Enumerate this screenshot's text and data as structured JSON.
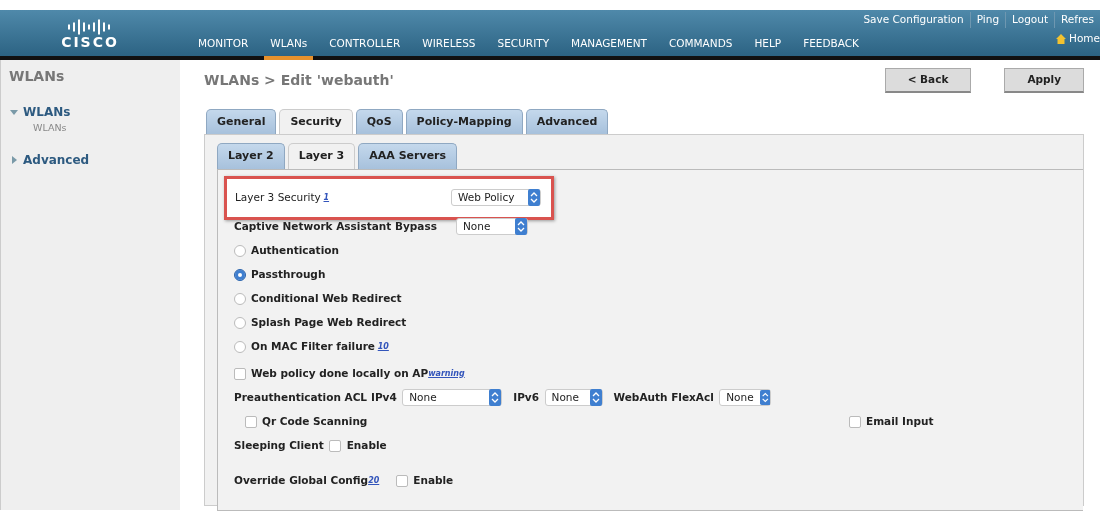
{
  "header": {
    "logo": "CISCO",
    "top_links": [
      "Save Configuration",
      "Ping",
      "Logout",
      "Refres"
    ],
    "nav": [
      {
        "label": "MONITOR",
        "selected": false
      },
      {
        "label": "WLANs",
        "selected": true
      },
      {
        "label": "CONTROLLER",
        "selected": false
      },
      {
        "label": "WIRELESS",
        "selected": false
      },
      {
        "label": "SECURITY",
        "selected": false
      },
      {
        "label": "MANAGEMENT",
        "selected": false
      },
      {
        "label": "COMMANDS",
        "selected": false
      },
      {
        "label": "HELP",
        "selected": false
      },
      {
        "label": "FEEDBACK",
        "selected": false
      }
    ],
    "home": "Home"
  },
  "sidebar": {
    "title": "WLANs",
    "items": [
      {
        "label": "WLANs",
        "expanded": true,
        "children": [
          {
            "label": "WLANs"
          }
        ]
      },
      {
        "label": "Advanced",
        "expanded": false
      }
    ]
  },
  "page": {
    "title": "WLANs > Edit  'webauth'",
    "buttons": [
      "< Back",
      "Apply"
    ]
  },
  "tabs": [
    {
      "label": "General",
      "selected": false
    },
    {
      "label": "Security",
      "selected": true
    },
    {
      "label": "QoS",
      "selected": false
    },
    {
      "label": "Policy-Mapping",
      "selected": false
    },
    {
      "label": "Advanced",
      "selected": false
    }
  ],
  "subtabs": [
    {
      "label": "Layer 2",
      "selected": false
    },
    {
      "label": "Layer 3",
      "selected": true
    },
    {
      "label": "AAA Servers",
      "selected": false
    }
  ],
  "form": {
    "layer3_security": {
      "label": "Layer 3 Security",
      "footnote": "1",
      "value": "Web Policy",
      "highlighted": true
    },
    "captive_bypass": {
      "label": "Captive Network Assistant Bypass",
      "value": "None"
    },
    "options": [
      {
        "label": "Authentication",
        "selected": false
      },
      {
        "label": "Passthrough",
        "selected": true
      },
      {
        "label": "Conditional Web Redirect",
        "selected": false
      },
      {
        "label": "Splash Page Web Redirect",
        "selected": false
      },
      {
        "label": "On MAC Filter failure",
        "footnote": "10",
        "selected": false
      }
    ],
    "web_policy_local": {
      "label": "Web policy done locally on AP",
      "footnote": "warning",
      "checked": false
    },
    "preauth": {
      "label": "Preauthentication ACL",
      "acls": [
        {
          "label": "IPv4",
          "value": "None"
        },
        {
          "label": "IPv6",
          "value": "None"
        },
        {
          "label": "WebAuth FlexAcl",
          "value": "None"
        }
      ]
    },
    "qr_code": {
      "label": "Qr Code Scanning",
      "checked": false
    },
    "email_input": {
      "label": "Email Input",
      "checked": false
    },
    "sleeping_client": {
      "label": "Sleeping Client",
      "option": "Enable",
      "checked": false
    },
    "override_global": {
      "label": "Override Global Config",
      "footnote": "20",
      "option": "Enable",
      "checked": false
    }
  }
}
